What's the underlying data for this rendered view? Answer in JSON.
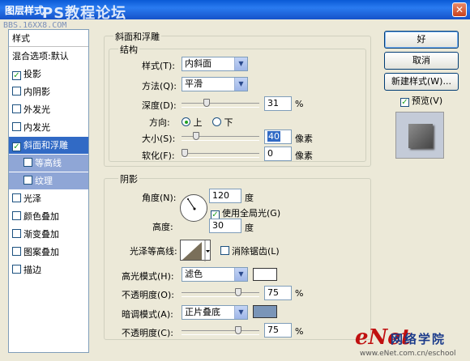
{
  "window": {
    "title": "图层样式",
    "watermark_top": "PS教程论坛",
    "watermark_url": "BBS.16XX8.COM"
  },
  "sidebar": {
    "header": "样式",
    "items": [
      {
        "label": "混合选项:默认",
        "checkbox": false,
        "checked": false,
        "state": "normal"
      },
      {
        "label": "投影",
        "checkbox": true,
        "checked": true,
        "state": "normal"
      },
      {
        "label": "内阴影",
        "checkbox": true,
        "checked": false,
        "state": "normal"
      },
      {
        "label": "外发光",
        "checkbox": true,
        "checked": false,
        "state": "normal"
      },
      {
        "label": "内发光",
        "checkbox": true,
        "checked": false,
        "state": "normal"
      },
      {
        "label": "斜面和浮雕",
        "checkbox": true,
        "checked": true,
        "state": "selected"
      },
      {
        "label": "等高线",
        "checkbox": true,
        "checked": false,
        "state": "sub"
      },
      {
        "label": "纹理",
        "checkbox": true,
        "checked": false,
        "state": "sub"
      },
      {
        "label": "光泽",
        "checkbox": true,
        "checked": false,
        "state": "normal"
      },
      {
        "label": "颜色叠加",
        "checkbox": true,
        "checked": false,
        "state": "normal"
      },
      {
        "label": "渐变叠加",
        "checkbox": true,
        "checked": false,
        "state": "normal"
      },
      {
        "label": "图案叠加",
        "checkbox": true,
        "checked": false,
        "state": "normal"
      },
      {
        "label": "描边",
        "checkbox": true,
        "checked": false,
        "state": "normal"
      }
    ]
  },
  "bevel": {
    "section_title": "斜面和浮雕",
    "structure_title": "结构",
    "style_label": "样式(T):",
    "style_value": "内斜面",
    "technique_label": "方法(Q):",
    "technique_value": "平滑",
    "depth_label": "深度(D):",
    "depth_value": "31",
    "depth_unit": "%",
    "depth_level": 0.31,
    "direction_label": "方向:",
    "dir_up": "上",
    "dir_down": "下",
    "size_label": "大小(S):",
    "size_value": "40",
    "size_unit": "像素",
    "size_level": 0.16,
    "soften_label": "软化(F):",
    "soften_value": "0",
    "soften_unit": "像素",
    "soften_level": 0
  },
  "shading": {
    "section_title": "阴影",
    "angle_label": "角度(N):",
    "angle_value": "120",
    "angle_unit": "度",
    "global_light_label": "使用全局光(G)",
    "altitude_label": "高度:",
    "altitude_value": "30",
    "altitude_unit": "度",
    "gloss_label": "光泽等高线:",
    "antialias_label": "消除锯齿(L)",
    "highlight_mode_label": "高光模式(H):",
    "highlight_mode_value": "滤色",
    "highlight_color": "#ffffff",
    "highlight_opacity_label": "不透明度(O):",
    "highlight_opacity_value": "75",
    "highlight_opacity_unit": "%",
    "highlight_opacity_level": 0.75,
    "shadow_mode_label": "暗调模式(A):",
    "shadow_mode_value": "正片叠底",
    "shadow_color": "#7a95b8",
    "shadow_opacity_label": "不透明度(C):",
    "shadow_opacity_value": "75",
    "shadow_opacity_unit": "%",
    "shadow_opacity_level": 0.75
  },
  "buttons": {
    "ok": "好",
    "cancel": "取消",
    "new_style": "新建样式(W)...",
    "preview": "预览(V)"
  },
  "branding": {
    "logo_e": "eNet",
    "logo_cn": "网络学院",
    "url": "www.eNet.com.cn/eschool"
  }
}
